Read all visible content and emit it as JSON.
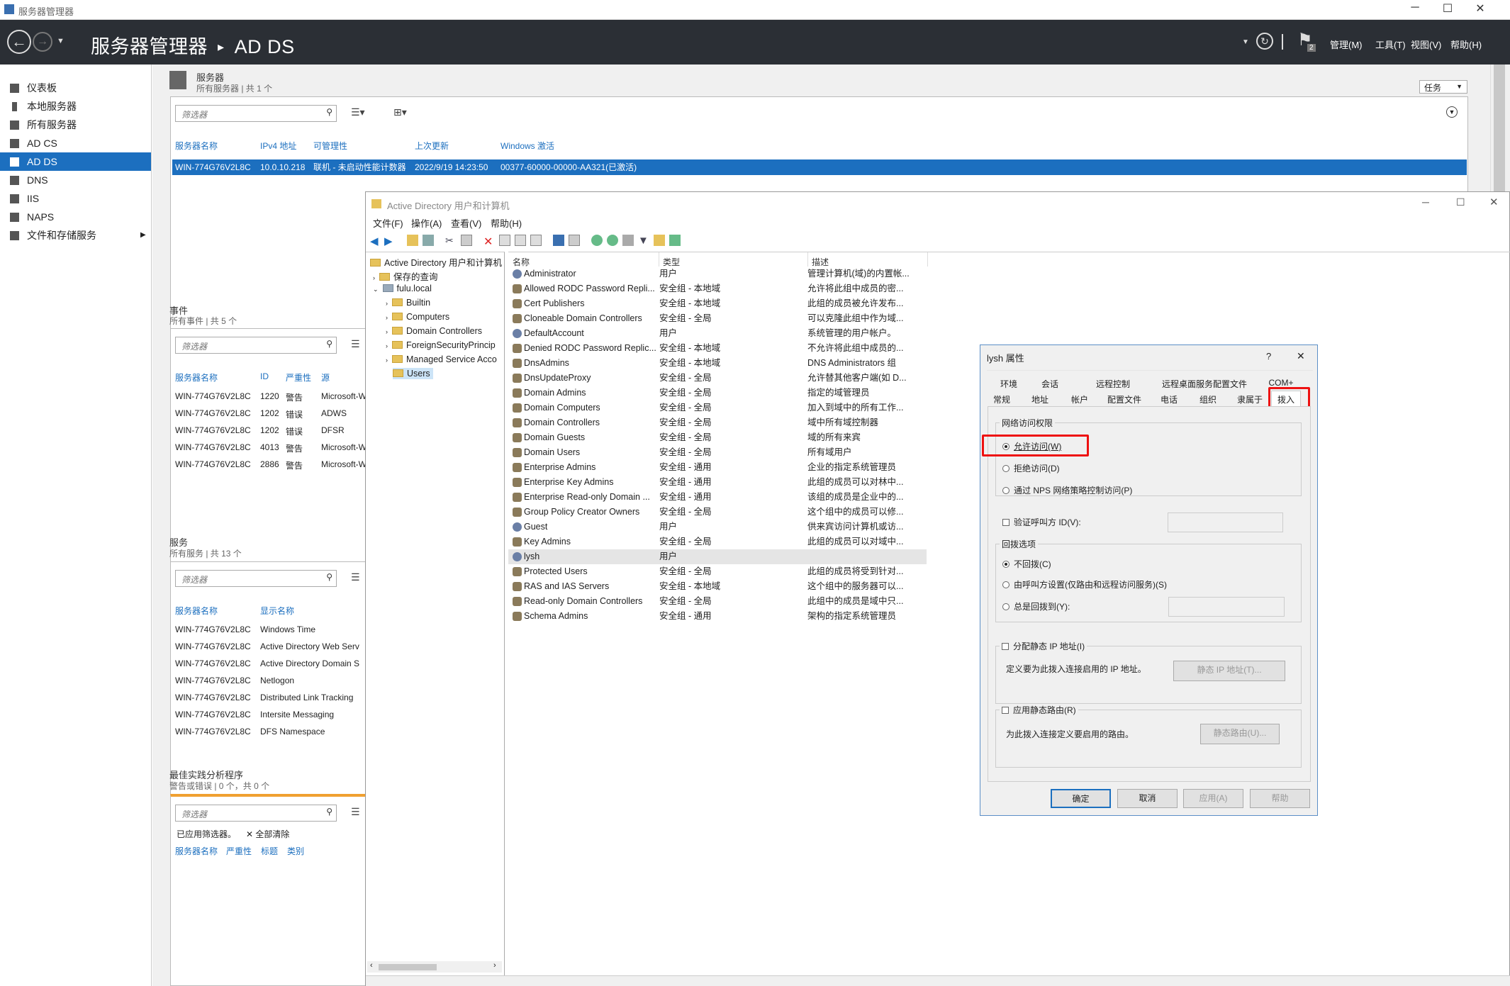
{
  "window": {
    "title": "服务器管理器"
  },
  "header": {
    "breadcrumb_app": "服务器管理器",
    "breadcrumb_sep": "▸",
    "breadcrumb_page": "AD DS",
    "notif_count": "2",
    "menus": [
      "管理(M)",
      "工具(T)",
      "视图(V)",
      "帮助(H)"
    ]
  },
  "sidebar": {
    "items": [
      {
        "label": "仪表板"
      },
      {
        "label": "本地服务器"
      },
      {
        "label": "所有服务器"
      },
      {
        "label": "AD CS"
      },
      {
        "label": "AD DS"
      },
      {
        "label": "DNS"
      },
      {
        "label": "IIS"
      },
      {
        "label": "NAPS"
      },
      {
        "label": "文件和存储服务"
      }
    ]
  },
  "servers": {
    "title": "服务器",
    "subtitle": "所有服务器 | 共 1 个",
    "tasks": "任务",
    "filter_placeholder": "筛选器",
    "columns": [
      "服务器名称",
      "IPv4 地址",
      "可管理性",
      "上次更新",
      "Windows 激活"
    ],
    "row": [
      "WIN-774G76V2L8C",
      "10.0.10.218",
      "联机 - 未启动性能计数器",
      "2022/9/19 14:23:50",
      "00377-60000-00000-AA321(已激活)"
    ]
  },
  "events": {
    "title": "事件",
    "subtitle": "所有事件 | 共 5 个",
    "filter_placeholder": "筛选器",
    "columns": [
      "服务器名称",
      "ID",
      "严重性",
      "源"
    ],
    "rows": [
      [
        "WIN-774G76V2L8C",
        "1220",
        "警告",
        "Microsoft-W"
      ],
      [
        "WIN-774G76V2L8C",
        "1202",
        "错误",
        "ADWS"
      ],
      [
        "WIN-774G76V2L8C",
        "1202",
        "错误",
        "DFSR"
      ],
      [
        "WIN-774G76V2L8C",
        "4013",
        "警告",
        "Microsoft-W"
      ],
      [
        "WIN-774G76V2L8C",
        "2886",
        "警告",
        "Microsoft-W"
      ]
    ]
  },
  "services": {
    "title": "服务",
    "subtitle": "所有服务 | 共 13 个",
    "filter_placeholder": "筛选器",
    "columns": [
      "服务器名称",
      "显示名称"
    ],
    "rows": [
      [
        "WIN-774G76V2L8C",
        "Windows Time"
      ],
      [
        "WIN-774G76V2L8C",
        "Active Directory Web Serv"
      ],
      [
        "WIN-774G76V2L8C",
        "Active Directory Domain S"
      ],
      [
        "WIN-774G76V2L8C",
        "Netlogon"
      ],
      [
        "WIN-774G76V2L8C",
        "Distributed Link Tracking"
      ],
      [
        "WIN-774G76V2L8C",
        "Intersite Messaging"
      ],
      [
        "WIN-774G76V2L8C",
        "DFS Namespace"
      ]
    ]
  },
  "bpa": {
    "title": "最佳实践分析程序",
    "subtitle": "警告或错误 | 0 个，共 0 个",
    "filter_placeholder": "筛选器",
    "applied": "已应用筛选器。",
    "clear": "全部清除",
    "columns": [
      "服务器名称",
      "严重性",
      "标题",
      "类别"
    ]
  },
  "aduc": {
    "title": "Active Directory 用户和计算机",
    "menus": [
      "文件(F)",
      "操作(A)",
      "查看(V)",
      "帮助(H)"
    ],
    "tree": [
      {
        "label": "Active Directory 用户和计算机"
      },
      {
        "label": "保存的查询"
      },
      {
        "label": "fulu.local"
      },
      {
        "label": "Builtin"
      },
      {
        "label": "Computers"
      },
      {
        "label": "Domain Controllers"
      },
      {
        "label": "ForeignSecurityPrincip"
      },
      {
        "label": "Managed Service Acco"
      },
      {
        "label": "Users"
      }
    ],
    "columns": [
      "名称",
      "类型",
      "描述"
    ],
    "rows": [
      {
        "name": "Administrator",
        "type": "用户",
        "desc": "管理计算机(域)的内置帐..."
      },
      {
        "name": "Allowed RODC Password Repli...",
        "type": "安全组 - 本地域",
        "desc": "允许将此组中成员的密..."
      },
      {
        "name": "Cert Publishers",
        "type": "安全组 - 本地域",
        "desc": "此组的成员被允许发布..."
      },
      {
        "name": "Cloneable Domain Controllers",
        "type": "安全组 - 全局",
        "desc": "可以克隆此组中作为域..."
      },
      {
        "name": "DefaultAccount",
        "type": "用户",
        "desc": "系统管理的用户帐户。"
      },
      {
        "name": "Denied RODC Password Replic...",
        "type": "安全组 - 本地域",
        "desc": "不允许将此组中成员的..."
      },
      {
        "name": "DnsAdmins",
        "type": "安全组 - 本地域",
        "desc": "DNS Administrators 组"
      },
      {
        "name": "DnsUpdateProxy",
        "type": "安全组 - 全局",
        "desc": "允许替其他客户端(如 D..."
      },
      {
        "name": "Domain Admins",
        "type": "安全组 - 全局",
        "desc": "指定的域管理员"
      },
      {
        "name": "Domain Computers",
        "type": "安全组 - 全局",
        "desc": "加入到域中的所有工作..."
      },
      {
        "name": "Domain Controllers",
        "type": "安全组 - 全局",
        "desc": "域中所有域控制器"
      },
      {
        "name": "Domain Guests",
        "type": "安全组 - 全局",
        "desc": "域的所有来宾"
      },
      {
        "name": "Domain Users",
        "type": "安全组 - 全局",
        "desc": "所有域用户"
      },
      {
        "name": "Enterprise Admins",
        "type": "安全组 - 通用",
        "desc": "企业的指定系统管理员"
      },
      {
        "name": "Enterprise Key Admins",
        "type": "安全组 - 通用",
        "desc": "此组的成员可以对林中..."
      },
      {
        "name": "Enterprise Read-only Domain ...",
        "type": "安全组 - 通用",
        "desc": "该组的成员是企业中的..."
      },
      {
        "name": "Group Policy Creator Owners",
        "type": "安全组 - 全局",
        "desc": "这个组中的成员可以修..."
      },
      {
        "name": "Guest",
        "type": "用户",
        "desc": "供来宾访问计算机或访..."
      },
      {
        "name": "Key Admins",
        "type": "安全组 - 全局",
        "desc": "此组的成员可以对域中..."
      },
      {
        "name": "lysh",
        "type": "用户",
        "desc": ""
      },
      {
        "name": "Protected Users",
        "type": "安全组 - 全局",
        "desc": "此组的成员将受到针对..."
      },
      {
        "name": "RAS and IAS Servers",
        "type": "安全组 - 本地域",
        "desc": "这个组中的服务器可以..."
      },
      {
        "name": "Read-only Domain Controllers",
        "type": "安全组 - 全局",
        "desc": "此组中的成员是域中只..."
      },
      {
        "name": "Schema Admins",
        "type": "安全组 - 通用",
        "desc": "架构的指定系统管理员"
      }
    ]
  },
  "dialog": {
    "title": "lysh 属性",
    "help": "?",
    "close": "✕",
    "tabs_row1": [
      "环境",
      "会话",
      "远程控制",
      "远程桌面服务配置文件",
      "COM+"
    ],
    "tabs_row2": [
      "常规",
      "地址",
      "帐户",
      "配置文件",
      "电话",
      "组织",
      "隶属于",
      "拨入"
    ],
    "network_group": "网络访问权限",
    "radio_allow": "允许访问(W)",
    "radio_deny": "拒绝访问(D)",
    "radio_nps": "通过 NPS 网络策略控制访问(P)",
    "verify_caller": "验证呼叫方 ID(V):",
    "callback_group": "回拨选项",
    "cb_none": "不回拨(C)",
    "cb_caller": "由呼叫方设置(仅路由和远程访问服务)(S)",
    "cb_always": "总是回拨到(Y):",
    "static_ip_check": "分配静态 IP 地址(I)",
    "static_ip_desc": "定义要为此拨入连接启用的 IP 地址。",
    "static_ip_btn": "静态 IP 地址(T)...",
    "static_route_check": "应用静态路由(R)",
    "static_route_desc": "为此拨入连接定义要启用的路由。",
    "static_route_btn": "静态路由(U)...",
    "ok": "确定",
    "cancel": "取消",
    "apply": "应用(A)",
    "helpbtn": "帮助"
  }
}
